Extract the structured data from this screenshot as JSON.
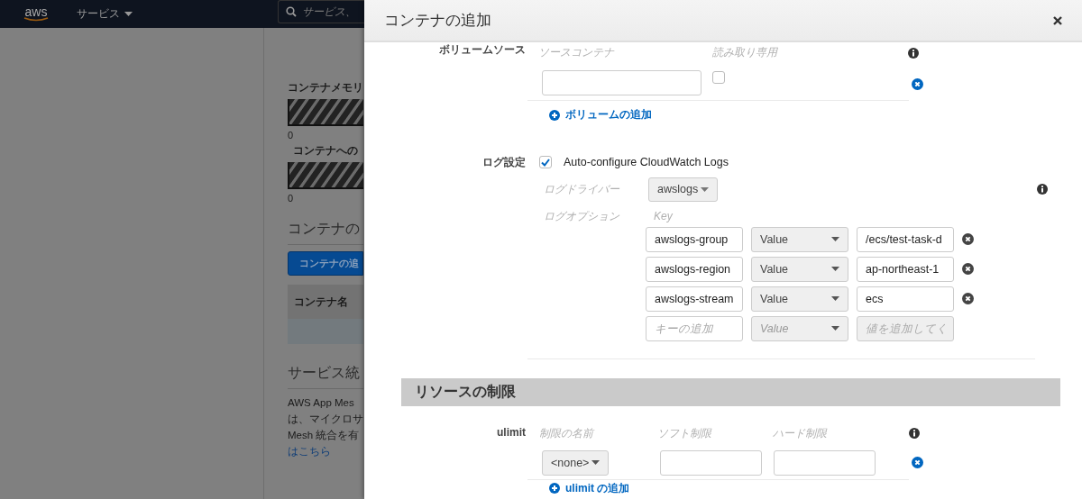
{
  "nav": {
    "logo": "aws",
    "services": "サービス",
    "search_placeholder": "サービス、"
  },
  "background": {
    "memory_label": "コンテナメモリ",
    "memory_value": "0",
    "cpu_label": "コンテナへの",
    "cpu_value": "0",
    "definitions_heading": "コンテナの",
    "add_button": "コンテナの追",
    "table_header": "コンテナ名",
    "integration_heading": "サービス統",
    "paragraph_lines": [
      "AWS App Mes",
      "は、マイクロサ",
      "Mesh 統合を有"
    ],
    "link": "はこちら"
  },
  "modal": {
    "title": "コンテナの追加"
  },
  "volume_source": {
    "label": "ボリュームソース",
    "columns": [
      "ソースコンテナ",
      "読み取り専用"
    ],
    "rows": [
      {
        "read_only": false
      }
    ],
    "add_link": "ボリュームの追加"
  },
  "log": {
    "label": "ログ設定",
    "auto_configure": {
      "label": "Auto-configure CloudWatch Logs",
      "checked": true
    },
    "driver_label": "ログドライバー",
    "driver": "awslogs",
    "options_label": "ログオプション",
    "key_header": "Key",
    "options": [
      {
        "kind": "entry",
        "key": "awslogs-group",
        "type": "Value",
        "value": "/ecs/test-task-d"
      },
      {
        "kind": "entry",
        "key": "awslogs-region",
        "type": "Value",
        "value": "ap-northeast-1"
      },
      {
        "kind": "entry",
        "key": "awslogs-stream",
        "type": "Value",
        "value": "ecs"
      },
      {
        "kind": "new",
        "key_placeholder": "キーの追加",
        "type": "Value",
        "value_placeholder": "値を追加してく"
      }
    ]
  },
  "resource_limits": {
    "heading": "リソースの制限",
    "ulimit": {
      "label": "ulimit",
      "columns": [
        "制限の名前",
        "ソフト制限",
        "ハード制限"
      ],
      "rows": [
        {
          "name": "<none>"
        }
      ],
      "add_link": "ulimit の追加"
    }
  }
}
